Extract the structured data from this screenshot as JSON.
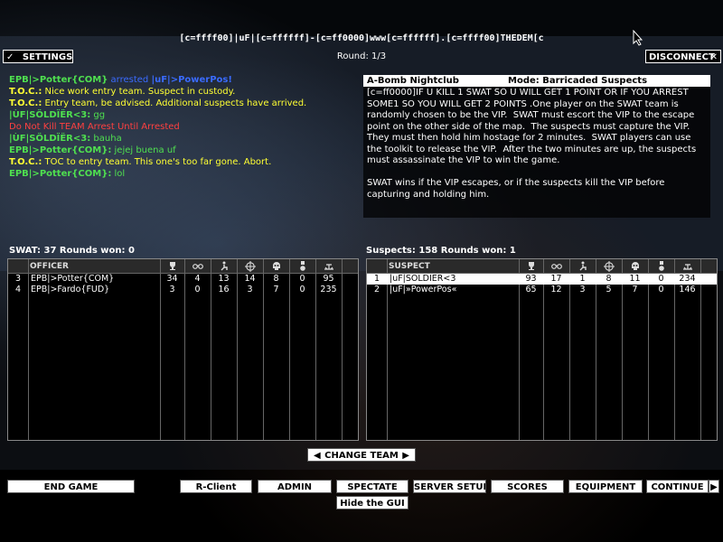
{
  "header": {
    "server_title": "[c=ffff00]|uF|[c=ffffff]-[c=ff0000]www[c=ffffff].[c=ffff00]THEDEM[c",
    "round": "Round: 1/3",
    "settings_label": "SETTINGS",
    "disconnect_label": "DISCONNECT"
  },
  "chat": [
    {
      "name": "EPB|>Potter{COM}",
      "name_color": "#4fe04f",
      "sep": " ",
      "text": "arrested ",
      "text_color": "#3a6bff",
      "extra": "|uF|>PowerPos!",
      "extra_color": "#3a6bff"
    },
    {
      "name": "T.O.C.:",
      "name_color": "#ffff33",
      "sep": " ",
      "text": "Nice work entry team.  Suspect in custody.",
      "text_color": "#ffff33"
    },
    {
      "name": "T.O.C.:",
      "name_color": "#ffff33",
      "sep": " ",
      "text": "Entry team, be advised.  Additional suspects have arrived.",
      "text_color": "#ffff33"
    },
    {
      "name": "|ÙF|SÖLDÏËR<3:",
      "name_color": "#4fe04f",
      "sep": " ",
      "text": "gg",
      "text_color": "#4fe04f"
    },
    {
      "name": "",
      "name_color": "#ff4040",
      "sep": "",
      "text": "Do Not Kill TEAM Arrest Until Arrested",
      "text_color": "#ff4040"
    },
    {
      "name": "|ÙF|SÖLDÏËR<3:",
      "name_color": "#4fe04f",
      "sep": " ",
      "text": "bauha",
      "text_color": "#4fe04f"
    },
    {
      "name": "EPB|>Potter{COM}:",
      "name_color": "#4fe04f",
      "sep": " ",
      "text": "jejej buena uf",
      "text_color": "#4fe04f"
    },
    {
      "name": "T.O.C.:",
      "name_color": "#ffff33",
      "sep": " ",
      "text": "TOC to entry team.  This one's too far gone.  Abort.",
      "text_color": "#ffff33"
    },
    {
      "name": "EPB|>Potter{COM}:",
      "name_color": "#4fe04f",
      "sep": " ",
      "text": "lol",
      "text_color": "#4fe04f"
    }
  ],
  "mode_panel": {
    "map": "A-Bomb Nightclub",
    "mode": "Mode: Barricaded Suspects",
    "description": "[c=ff0000]IF U KILL 1 SWAT SO U WILL GET 1 POINT OR IF YOU ARREST SOME1 SO YOU WILL GET 2 POINTS .One player on the SWAT team is randomly chosen to be the VIP.  SWAT must escort the VIP to the escape point on the other side of the map.  The suspects must capture the VIP.  They must then hold him hostage for 2 minutes.  SWAT players can use the toolkit to release the VIP.  After the two minutes are up, the suspects must assassinate the VIP to win the game.\n\nSWAT wins if the VIP escapes, or if the suspects kill the VIP before capturing and holding him."
  },
  "swat": {
    "label": "SWAT: 37    Rounds won: 0",
    "header": "OFFICER",
    "rows": [
      {
        "idx": "3",
        "name": "EPB|>Potter{COM}",
        "c1": "34",
        "c2": "4",
        "c3": "13",
        "c4": "14",
        "c5": "8",
        "c6": "0",
        "c7": "95"
      },
      {
        "idx": "4",
        "name": "EPB|>Fardo{FUD}",
        "c1": "3",
        "c2": "0",
        "c3": "16",
        "c4": "3",
        "c5": "7",
        "c6": "0",
        "c7": "235"
      }
    ]
  },
  "suspects": {
    "label": "Suspects: 158    Rounds won: 1",
    "header": "SUSPECT",
    "rows": [
      {
        "idx": "1",
        "name": "|uF|SÖLDÏËR<3",
        "c1": "93",
        "c2": "17",
        "c3": "1",
        "c4": "8",
        "c5": "11",
        "c6": "0",
        "c7": "234"
      },
      {
        "idx": "2",
        "name": "|uF|»PowerPos«",
        "c1": "65",
        "c2": "12",
        "c3": "3",
        "c4": "5",
        "c5": "7",
        "c6": "0",
        "c7": "146"
      }
    ]
  },
  "icons": [
    "trophy-icon",
    "handcuffs-icon",
    "kneeling-icon",
    "crosshair-icon",
    "skull-icon",
    "medal-icon",
    "timer-icon"
  ],
  "buttons": {
    "change_team": "CHANGE TEAM",
    "end_game": "END GAME",
    "rclient": "R-Client",
    "admin": "ADMIN",
    "spectate": "SPECTATE",
    "server_setup": "SERVER SETUP",
    "scores": "SCORES",
    "equipment": "EQUIPMENT",
    "continue": "CONTINUE",
    "hide_gui": "Hide the GUI"
  }
}
